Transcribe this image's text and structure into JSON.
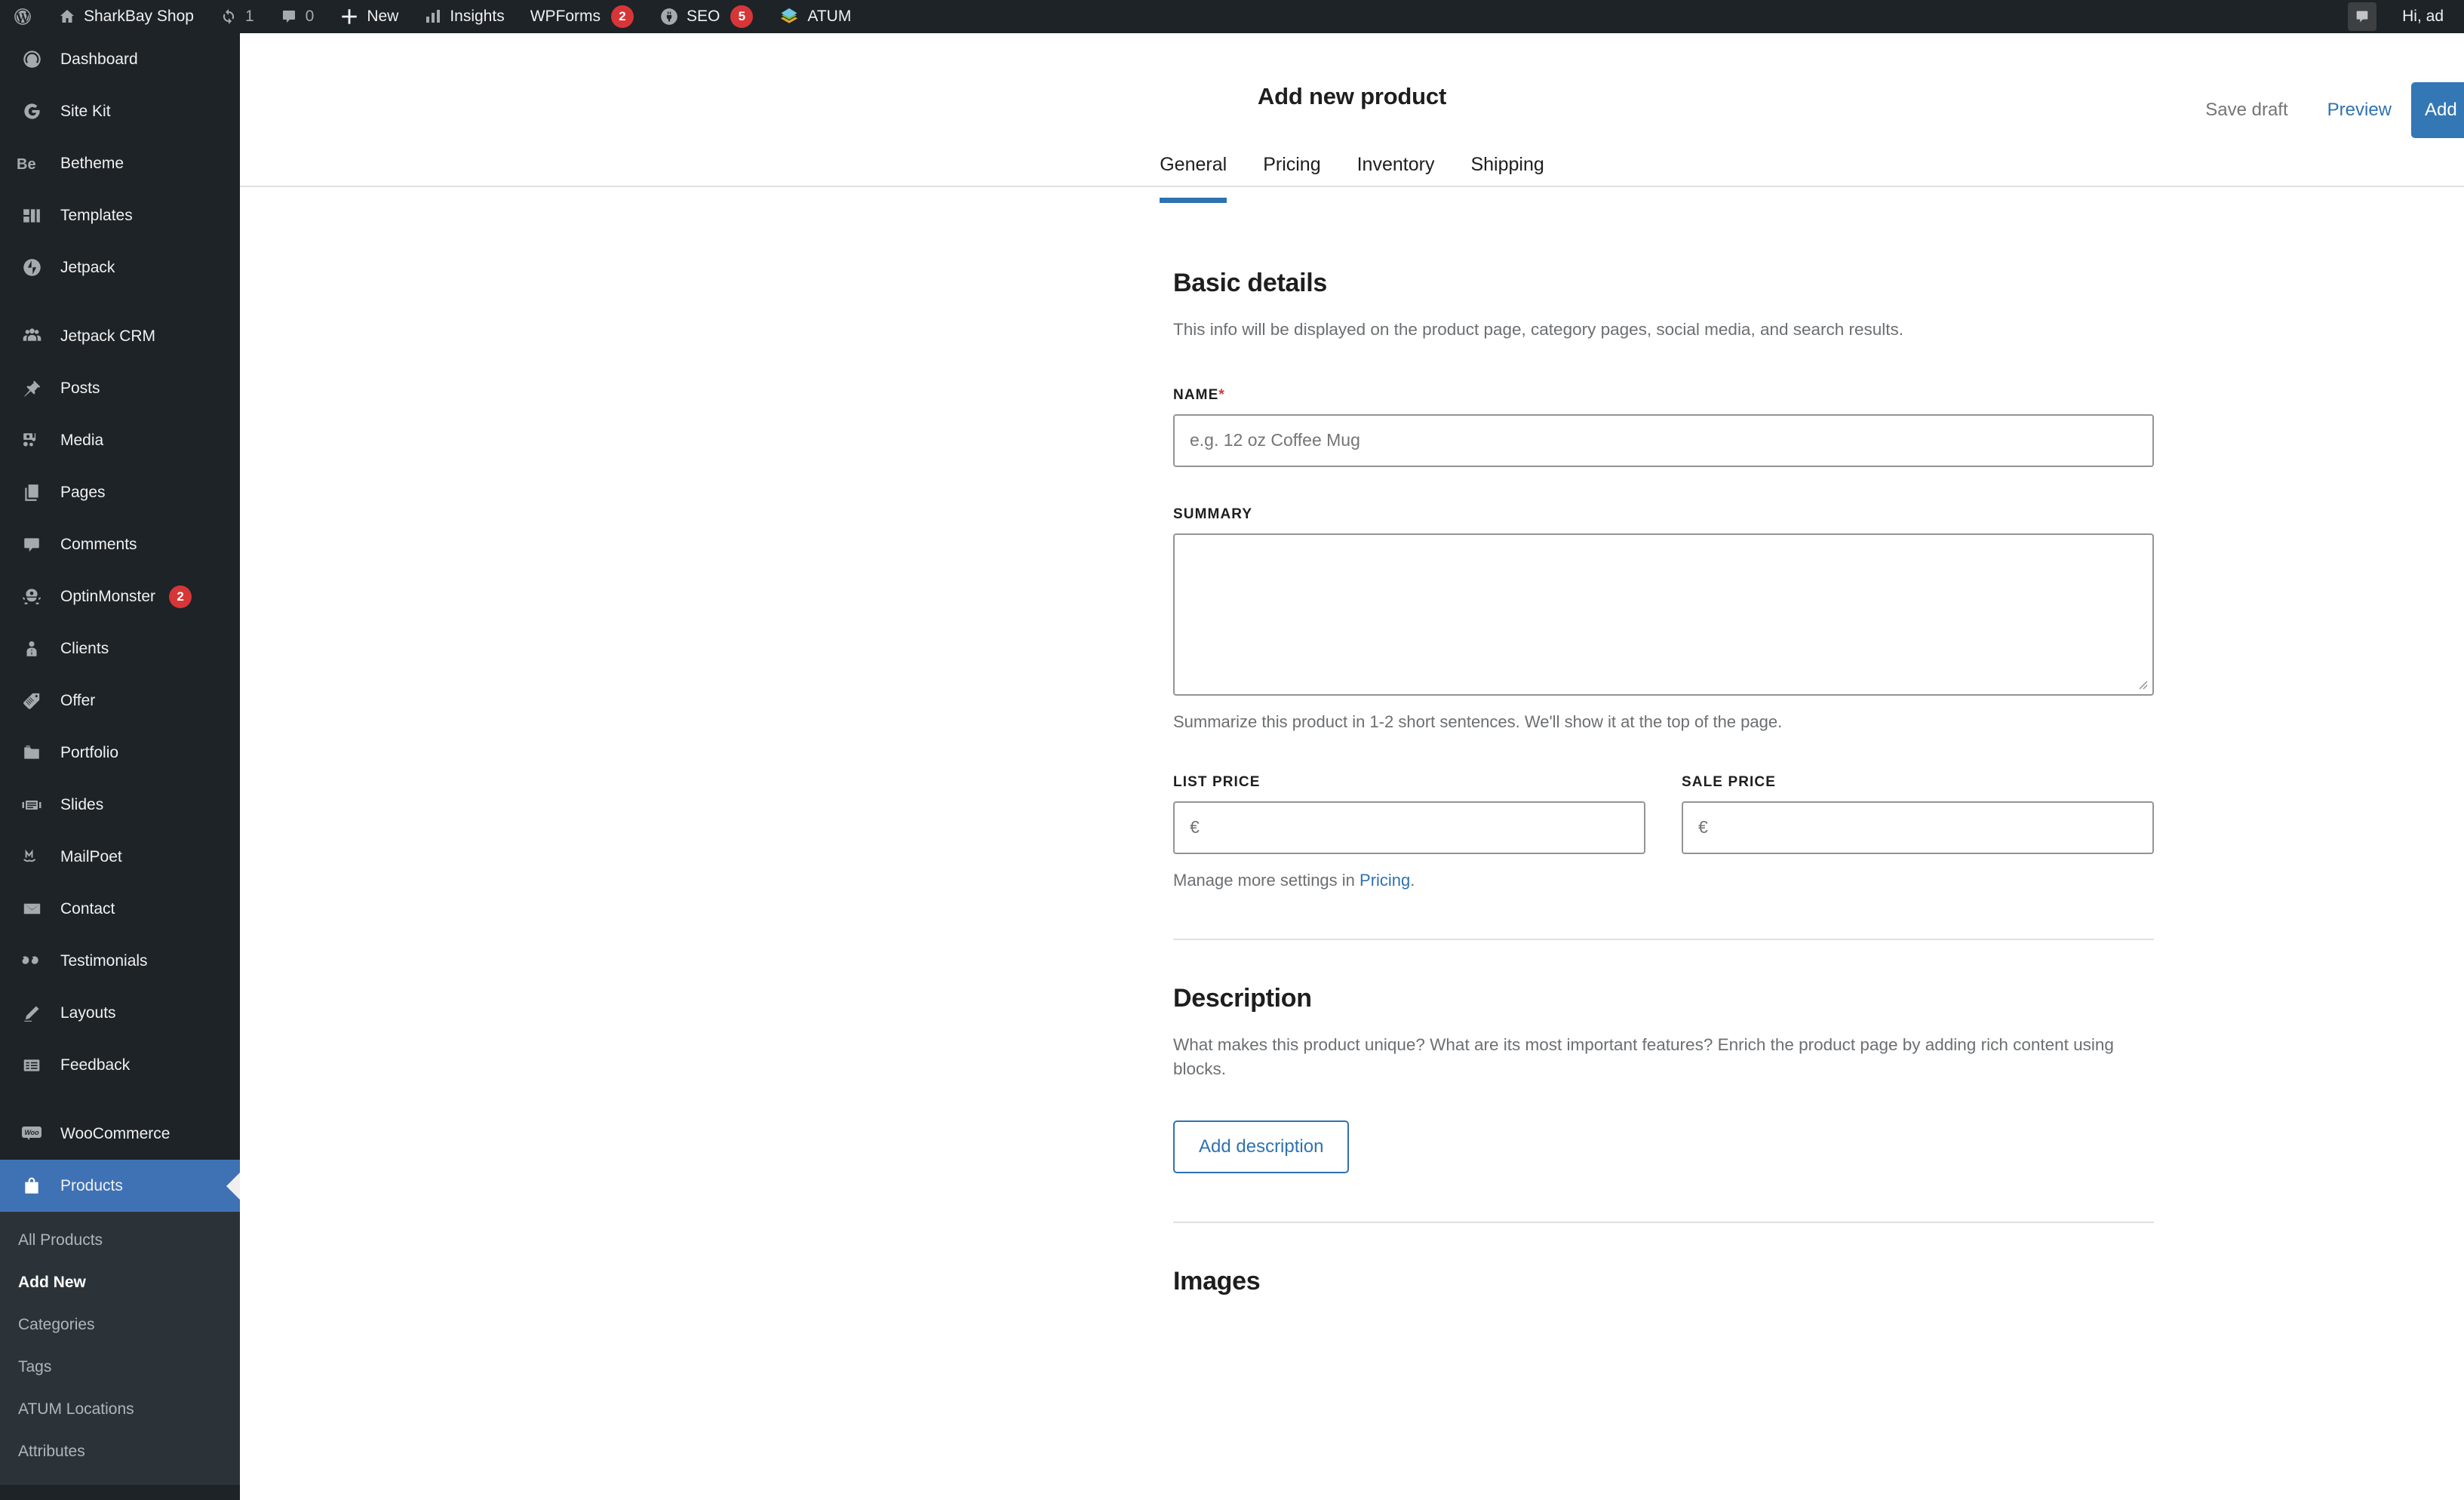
{
  "adminbar": {
    "left_items": [
      {
        "icon": "wordpress-logo-icon",
        "label": "",
        "count": ""
      },
      {
        "icon": "home-icon",
        "label": "SharkBay Shop",
        "count": ""
      },
      {
        "icon": "updates-icon",
        "label": "",
        "count": "1"
      },
      {
        "icon": "comment-bubble-icon",
        "label": "",
        "count": "0"
      },
      {
        "icon": "plus-icon",
        "label": "New",
        "count": ""
      },
      {
        "icon": "bar-chart-icon",
        "label": "Insights",
        "count": ""
      },
      {
        "icon": "",
        "label": "WPForms",
        "badge": "2"
      },
      {
        "icon": "gear-plug-icon",
        "label": "SEO",
        "badge": "5"
      },
      {
        "icon": "atum-layers-icon",
        "label": "ATUM",
        "count": ""
      }
    ],
    "right": {
      "chip_icon": "comment-bubble-icon",
      "greeting": "Hi, ad"
    }
  },
  "sidebar": {
    "items": [
      {
        "label": "Dashboard",
        "icon": "dashboard-icon",
        "spaced": false
      },
      {
        "label": "Site Kit",
        "icon": "google-g-icon",
        "spaced": false
      },
      {
        "label": "Betheme",
        "icon": "betheme-icon",
        "spaced": false
      },
      {
        "label": "Templates",
        "icon": "templates-icon",
        "spaced": false
      },
      {
        "label": "Jetpack",
        "icon": "jetpack-icon",
        "spaced": false
      },
      {
        "label": "Jetpack CRM",
        "icon": "jetpack-crm-icon",
        "spaced": true
      },
      {
        "label": "Posts",
        "icon": "pin-icon",
        "spaced": false
      },
      {
        "label": "Media",
        "icon": "media-icon",
        "spaced": false
      },
      {
        "label": "Pages",
        "icon": "pages-icon",
        "spaced": false
      },
      {
        "label": "Comments",
        "icon": "comment-bubble-icon",
        "spaced": false
      },
      {
        "label": "OptinMonster",
        "icon": "optinmonster-icon",
        "badge": "2",
        "spaced": false
      },
      {
        "label": "Clients",
        "icon": "clients-icon",
        "spaced": false
      },
      {
        "label": "Offer",
        "icon": "tag-icon",
        "spaced": false
      },
      {
        "label": "Portfolio",
        "icon": "portfolio-icon",
        "spaced": false
      },
      {
        "label": "Slides",
        "icon": "slides-icon",
        "spaced": false
      },
      {
        "label": "MailPoet",
        "icon": "mailpoet-icon",
        "spaced": false
      },
      {
        "label": "Contact",
        "icon": "envelope-icon",
        "spaced": false
      },
      {
        "label": "Testimonials",
        "icon": "quote-icon",
        "spaced": false
      },
      {
        "label": "Layouts",
        "icon": "pencil-icon",
        "spaced": false
      },
      {
        "label": "Feedback",
        "icon": "feedback-icon",
        "spaced": false
      },
      {
        "label": "WooCommerce",
        "icon": "woocommerce-icon",
        "spaced": true
      },
      {
        "label": "Products",
        "icon": "products-bag-icon",
        "spaced": false,
        "active": true
      }
    ],
    "submenu": [
      {
        "label": "All Products",
        "current": false
      },
      {
        "label": "Add New",
        "current": true
      },
      {
        "label": "Categories",
        "current": false
      },
      {
        "label": "Tags",
        "current": false
      },
      {
        "label": "ATUM Locations",
        "current": false
      },
      {
        "label": "Attributes",
        "current": false
      }
    ]
  },
  "header": {
    "title": "Add new product",
    "tabs": [
      {
        "label": "General",
        "active": true
      },
      {
        "label": "Pricing",
        "active": false
      },
      {
        "label": "Inventory",
        "active": false
      },
      {
        "label": "Shipping",
        "active": false
      }
    ],
    "save_draft_label": "Save draft",
    "preview_label": "Preview",
    "primary_button_label": "Add"
  },
  "basic_details": {
    "title": "Basic details",
    "description": "This info will be displayed on the product page, category pages, social media, and search results.",
    "name_label": "NAME",
    "name_required_marker": "*",
    "name_value": "",
    "name_placeholder": "e.g. 12 oz Coffee Mug",
    "summary_label": "SUMMARY",
    "summary_value": "",
    "summary_placeholder": "",
    "summary_help": "Summarize this product in 1-2 short sentences. We'll show it at the top of the page.",
    "list_price_label": "LIST PRICE",
    "list_price_value": "",
    "list_price_placeholder": "€",
    "sale_price_label": "SALE PRICE",
    "sale_price_value": "",
    "sale_price_placeholder": "€",
    "pricing_help_prefix": "Manage more settings in ",
    "pricing_help_link": "Pricing",
    "pricing_help_suffix": "."
  },
  "description_section": {
    "title": "Description",
    "description": "What makes this product unique? What are its most important features? Enrich the product page by adding rich content using blocks.",
    "add_button_label": "Add description"
  },
  "images_section": {
    "title": "Images"
  },
  "colors": {
    "accent_blue": "#2f72b0",
    "active_menu_blue": "#3f72b5",
    "badge_red": "#d63638",
    "admin_dark": "#1d2327",
    "submenu_dark": "#2c3338"
  }
}
